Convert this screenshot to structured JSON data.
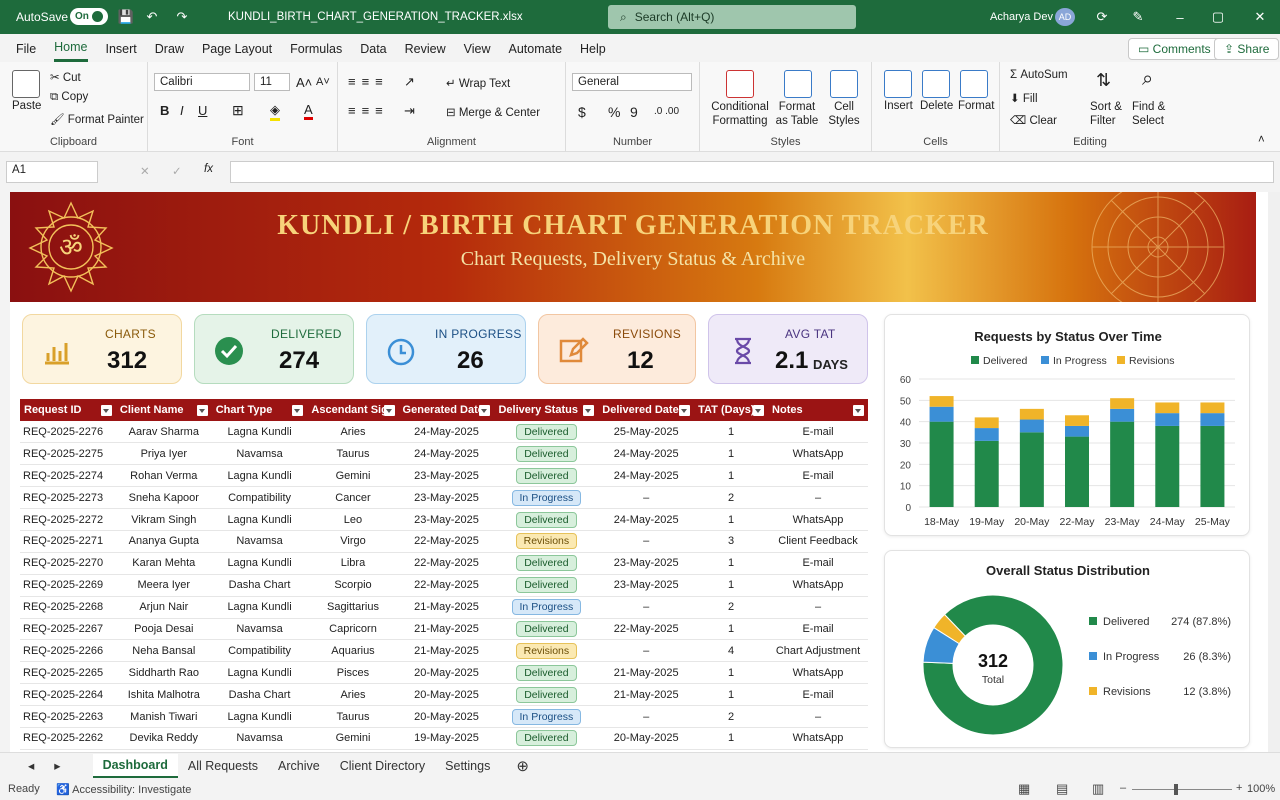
{
  "titlebar": {
    "autosave_label": "AutoSave",
    "toggle_label": "On",
    "filename": "KUNDLI_BIRTH_CHART_GENERATION_TRACKER.xlsx",
    "search_placeholder": "Search (Alt+Q)",
    "user_name": "Acharya Dev",
    "user_initials": "AD"
  },
  "menu": {
    "items": [
      "File",
      "Home",
      "Insert",
      "Draw",
      "Page Layout",
      "Formulas",
      "Data",
      "Review",
      "View",
      "Automate",
      "Help"
    ],
    "comments_label": "Comments",
    "share_label": "Share"
  },
  "ribbon": {
    "clipboard": {
      "label": "Clipboard",
      "paste": "Paste",
      "cut": "Cut",
      "copy": "Copy",
      "format_painter": "Format Painter"
    },
    "font": {
      "label": "Font",
      "family": "Calibri",
      "size": "11"
    },
    "alignment": {
      "label": "Alignment",
      "wrap": "Wrap Text",
      "merge": "Merge & Center"
    },
    "number": {
      "label": "Number",
      "format": "General"
    },
    "styles": {
      "label": "Styles",
      "conditional": "Conditional Formatting",
      "format_table": "Format as Table",
      "cell_styles": "Cell Styles"
    },
    "cells": {
      "label": "Cells",
      "insert": "Insert",
      "delete": "Delete",
      "format": "Format"
    },
    "editing": {
      "label": "Editing",
      "autosum": "AutoSum",
      "fill": "Fill",
      "clear": "Clear",
      "sort": "Sort & Filter",
      "find": "Find & Select"
    }
  },
  "formula_bar": {
    "name_box": "A1",
    "formula": ""
  },
  "banner": {
    "title": "KUNDLI / BIRTH CHART GENERATION TRACKER",
    "subtitle": "Chart Requests, Delivery Status & Archive"
  },
  "kpis": [
    {
      "label": "CHARTS",
      "value": "312",
      "unit": ""
    },
    {
      "label": "DELIVERED",
      "value": "274",
      "unit": ""
    },
    {
      "label": "IN PROGRESS",
      "value": "26",
      "unit": ""
    },
    {
      "label": "REVISIONS",
      "value": "12",
      "unit": ""
    },
    {
      "label": "AVG TAT",
      "value": "2.1",
      "unit": "DAYS"
    }
  ],
  "table": {
    "headers": [
      "Request ID",
      "Client Name",
      "Chart Type",
      "Ascendant Sign",
      "Generated Date",
      "Delivery Status",
      "Delivered Date",
      "TAT (Days)",
      "Notes"
    ],
    "rows": [
      [
        "REQ-2025-2276",
        "Aarav Sharma",
        "Lagna Kundli",
        "Aries",
        "24-May-2025",
        "Delivered",
        "25-May-2025",
        "1",
        "E-mail"
      ],
      [
        "REQ-2025-2275",
        "Priya Iyer",
        "Navamsa",
        "Taurus",
        "24-May-2025",
        "Delivered",
        "24-May-2025",
        "1",
        "WhatsApp"
      ],
      [
        "REQ-2025-2274",
        "Rohan Verma",
        "Lagna Kundli",
        "Gemini",
        "23-May-2025",
        "Delivered",
        "24-May-2025",
        "1",
        "E-mail"
      ],
      [
        "REQ-2025-2273",
        "Sneha Kapoor",
        "Compatibility",
        "Cancer",
        "23-May-2025",
        "In Progress",
        "–",
        "2",
        "–"
      ],
      [
        "REQ-2025-2272",
        "Vikram Singh",
        "Lagna Kundli",
        "Leo",
        "23-May-2025",
        "Delivered",
        "24-May-2025",
        "1",
        "WhatsApp"
      ],
      [
        "REQ-2025-2271",
        "Ananya Gupta",
        "Navamsa",
        "Virgo",
        "22-May-2025",
        "Revisions",
        "–",
        "3",
        "Client Feedback"
      ],
      [
        "REQ-2025-2270",
        "Karan Mehta",
        "Lagna Kundli",
        "Libra",
        "22-May-2025",
        "Delivered",
        "23-May-2025",
        "1",
        "E-mail"
      ],
      [
        "REQ-2025-2269",
        "Meera Iyer",
        "Dasha Chart",
        "Scorpio",
        "22-May-2025",
        "Delivered",
        "23-May-2025",
        "1",
        "WhatsApp"
      ],
      [
        "REQ-2025-2268",
        "Arjun Nair",
        "Lagna Kundli",
        "Sagittarius",
        "21-May-2025",
        "In Progress",
        "–",
        "2",
        "–"
      ],
      [
        "REQ-2025-2267",
        "Pooja Desai",
        "Navamsa",
        "Capricorn",
        "21-May-2025",
        "Delivered",
        "22-May-2025",
        "1",
        "E-mail"
      ],
      [
        "REQ-2025-2266",
        "Neha Bansal",
        "Compatibility",
        "Aquarius",
        "21-May-2025",
        "Revisions",
        "–",
        "4",
        "Chart Adjustment"
      ],
      [
        "REQ-2025-2265",
        "Siddharth Rao",
        "Lagna Kundli",
        "Pisces",
        "20-May-2025",
        "Delivered",
        "21-May-2025",
        "1",
        "WhatsApp"
      ],
      [
        "REQ-2025-2264",
        "Ishita Malhotra",
        "Dasha Chart",
        "Aries",
        "20-May-2025",
        "Delivered",
        "21-May-2025",
        "1",
        "E-mail"
      ],
      [
        "REQ-2025-2263",
        "Manish Tiwari",
        "Lagna Kundli",
        "Taurus",
        "20-May-2025",
        "In Progress",
        "–",
        "2",
        "–"
      ],
      [
        "REQ-2025-2262",
        "Devika Reddy",
        "Navamsa",
        "Gemini",
        "19-May-2025",
        "Delivered",
        "20-May-2025",
        "1",
        "WhatsApp"
      ]
    ]
  },
  "chart_data": [
    {
      "type": "bar",
      "stacked": true,
      "title": "Requests by Status Over Time",
      "categories": [
        "18-May",
        "19-May",
        "20-May",
        "22-May",
        "23-May",
        "24-May",
        "25-May"
      ],
      "series": [
        {
          "name": "Delivered",
          "color": "#21894a",
          "values": [
            40,
            31,
            35,
            33,
            40,
            38,
            38
          ]
        },
        {
          "name": "In Progress",
          "color": "#3b8fd6",
          "values": [
            7,
            6,
            6,
            5,
            6,
            6,
            6
          ]
        },
        {
          "name": "Revisions",
          "color": "#f0b429",
          "values": [
            5,
            5,
            5,
            5,
            5,
            5,
            5
          ]
        }
      ],
      "ylim": [
        0,
        60
      ],
      "yticks": [
        0,
        10,
        20,
        30,
        40,
        50,
        60
      ],
      "legend": "top",
      "grid": true
    },
    {
      "type": "pie",
      "donut": true,
      "title": "Overall Status Distribution",
      "center_value": "312",
      "center_label": "Total",
      "slices": [
        {
          "name": "Delivered",
          "value": 274,
          "label": "274 (87.8%)",
          "color": "#21894a"
        },
        {
          "name": "In Progress",
          "value": 26,
          "label": "26 (8.3%)",
          "color": "#3b8fd6"
        },
        {
          "name": "Revisions",
          "value": 12,
          "label": "12 (3.8%)",
          "color": "#f0b429"
        }
      ],
      "legend": "right"
    }
  ],
  "sheet_tabs": [
    "Dashboard",
    "All Requests",
    "Archive",
    "Client Directory",
    "Settings"
  ],
  "status": {
    "ready": "Ready",
    "accessibility": "Accessibility: Investigate",
    "zoom": "100%"
  }
}
